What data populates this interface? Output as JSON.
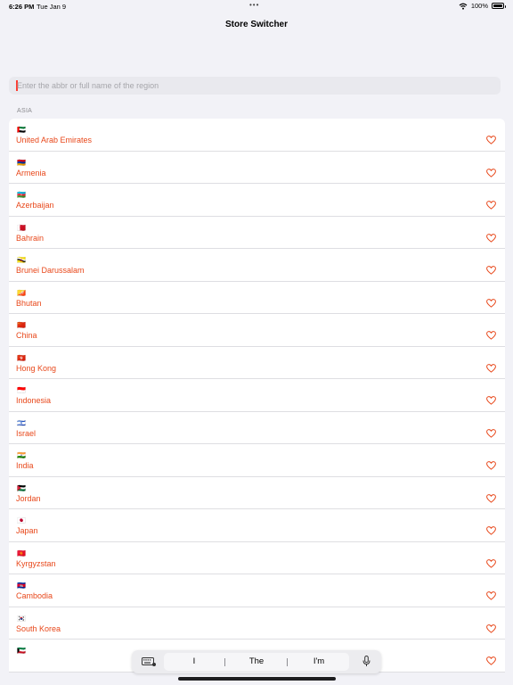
{
  "status": {
    "time": "6:26 PM",
    "date": "Tue Jan 9",
    "battery": "100%",
    "battery_level": 1.0
  },
  "nav": {
    "title": "Store Switcher"
  },
  "search": {
    "placeholder": "Enter the abbr or full name of the region",
    "value": ""
  },
  "section": {
    "header": "ASIA"
  },
  "colors": {
    "accent": "#e8481b",
    "background": "#f2f2f7",
    "caret": "#ff3b30"
  },
  "regions": [
    {
      "flag": "🇦🇪",
      "name": "United Arab Emirates"
    },
    {
      "flag": "🇦🇲",
      "name": "Armenia"
    },
    {
      "flag": "🇦🇿",
      "name": "Azerbaijan"
    },
    {
      "flag": "🇧🇭",
      "name": "Bahrain"
    },
    {
      "flag": "🇧🇳",
      "name": "Brunei Darussalam"
    },
    {
      "flag": "🇧🇹",
      "name": "Bhutan"
    },
    {
      "flag": "🇨🇳",
      "name": "China"
    },
    {
      "flag": "🇭🇰",
      "name": "Hong Kong"
    },
    {
      "flag": "🇮🇩",
      "name": "Indonesia"
    },
    {
      "flag": "🇮🇱",
      "name": "Israel"
    },
    {
      "flag": "🇮🇳",
      "name": "India"
    },
    {
      "flag": "🇯🇴",
      "name": "Jordan"
    },
    {
      "flag": "🇯🇵",
      "name": "Japan"
    },
    {
      "flag": "🇰🇬",
      "name": "Kyrgyzstan"
    },
    {
      "flag": "🇰🇭",
      "name": "Cambodia"
    },
    {
      "flag": "🇰🇷",
      "name": "South Korea"
    },
    {
      "flag": "🇰🇼",
      "name": ""
    }
  ],
  "keyboard": {
    "suggestions": [
      "I",
      "The",
      "I'm"
    ],
    "left_icon": "keyboard-icon",
    "right_icon": "microphone-icon"
  }
}
